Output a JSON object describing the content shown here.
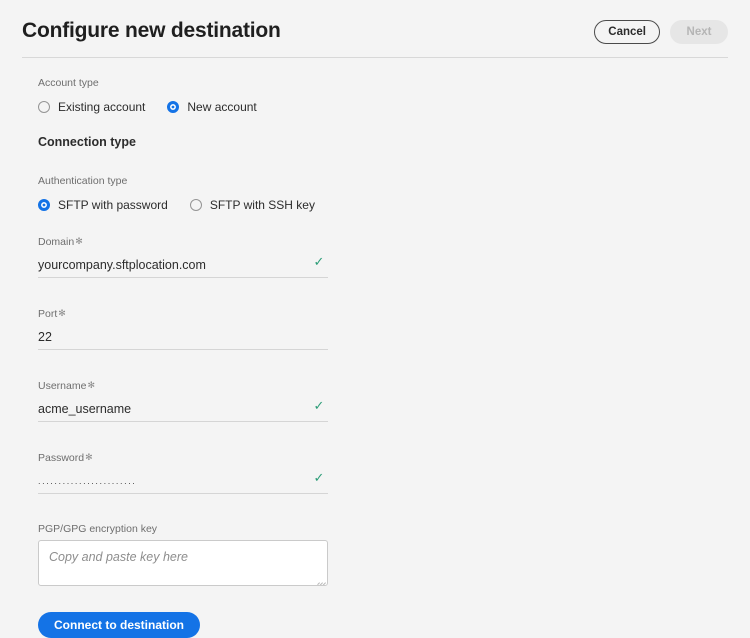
{
  "header": {
    "title": "Configure new destination",
    "cancel_label": "Cancel",
    "next_label": "Next"
  },
  "account_type": {
    "label": "Account type",
    "options": [
      {
        "label": "Existing account",
        "selected": false
      },
      {
        "label": "New account",
        "selected": true
      }
    ]
  },
  "connection_type": {
    "heading": "Connection type"
  },
  "authentication_type": {
    "label": "Authentication type",
    "options": [
      {
        "label": "SFTP with password",
        "selected": true
      },
      {
        "label": "SFTP with SSH key",
        "selected": false
      }
    ]
  },
  "fields": {
    "domain": {
      "label": "Domain",
      "required_marker": "✻",
      "value": "yourcompany.sftplocation.com",
      "valid": true,
      "valid_icon": "check-icon"
    },
    "port": {
      "label": "Port",
      "required_marker": "✻",
      "value": "22",
      "valid": false
    },
    "username": {
      "label": "Username",
      "required_marker": "✻",
      "value": "acme_username",
      "valid": true,
      "valid_icon": "check-icon"
    },
    "password": {
      "label": "Password",
      "required_marker": "✻",
      "value": "........................",
      "valid": true,
      "valid_icon": "check-icon"
    },
    "pgp_key": {
      "label": "PGP/GPG encryption key",
      "placeholder": "Copy and paste key here",
      "value": ""
    }
  },
  "submit": {
    "label": "Connect to destination"
  },
  "colors": {
    "accent_blue": "#1473E6",
    "valid_green": "#2D9D78",
    "page_background": "#F4F4F4",
    "label_gray": "#6E6E6E",
    "divider": "#D8D8D8"
  }
}
